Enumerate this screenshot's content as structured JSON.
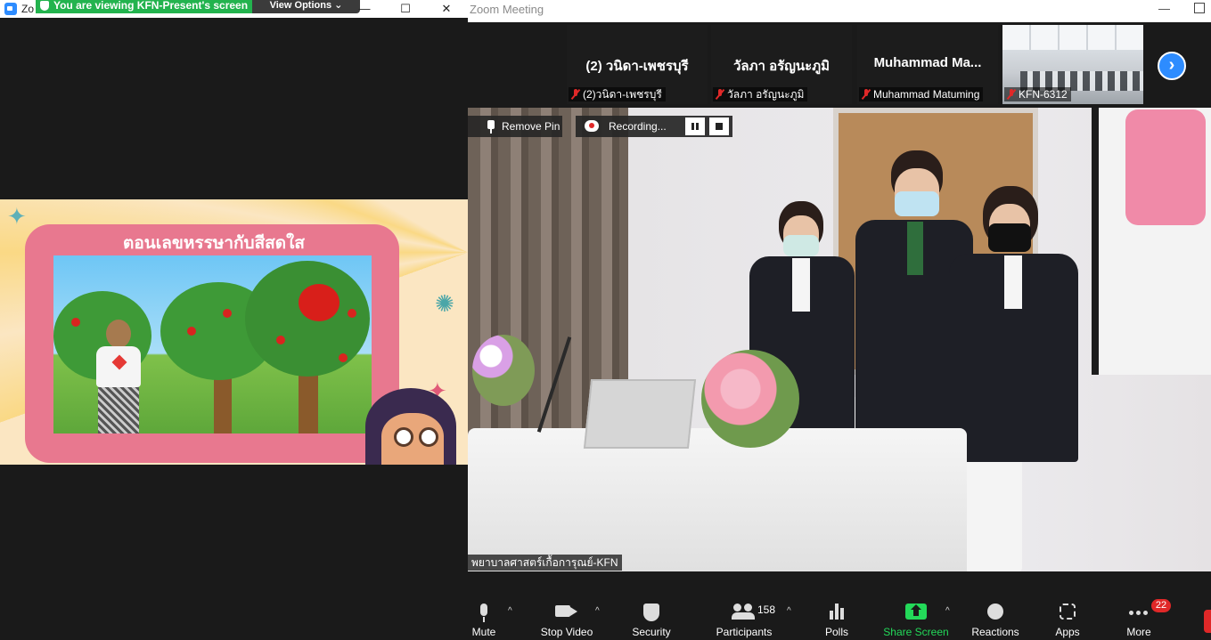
{
  "left_window": {
    "app_label": "Zo",
    "viewing_banner": "You are viewing KFN-Present's screen",
    "view_options": "View Options",
    "controls": {
      "minimize": "—",
      "maximize": "☐",
      "close": "✕"
    },
    "shared_slide_title": "ตอนเลขหรรษากับสีสดใส"
  },
  "meeting": {
    "window_title": "Zoom Meeting",
    "thumbnails": [
      {
        "big_name": "(2) วนิดา-เพชรบุรี",
        "tag": "(2)วนิดา-เพชรบุรี",
        "muted": true
      },
      {
        "big_name": "วัลภา อรัญนะภูมิ",
        "tag": "วัลภา อรัญนะภูมิ",
        "muted": true
      },
      {
        "big_name": "Muhammad  Ma...",
        "tag": "Muhammad Matuming",
        "muted": true
      },
      {
        "big_name": "",
        "tag": "KFN-6312",
        "muted": true,
        "video": true
      }
    ],
    "next_page": "›",
    "remove_pin": "Remove Pin",
    "recording": "Recording...",
    "speaker_name": "พยาบาลศาสตร์เกื้อการุณย์-KFN"
  },
  "toolbar": {
    "mute": "Mute",
    "stop_video": "Stop Video",
    "security": "Security",
    "participants": "Participants",
    "participant_count": "158",
    "polls": "Polls",
    "share_screen": "Share Screen",
    "reactions": "Reactions",
    "apps": "Apps",
    "more": "More",
    "more_badge": "22",
    "caret": "^"
  },
  "colors": {
    "zoom_blue": "#2d8cff",
    "share_green": "#23d959",
    "banner_green": "#23b34e",
    "alert_red": "#e02828"
  }
}
